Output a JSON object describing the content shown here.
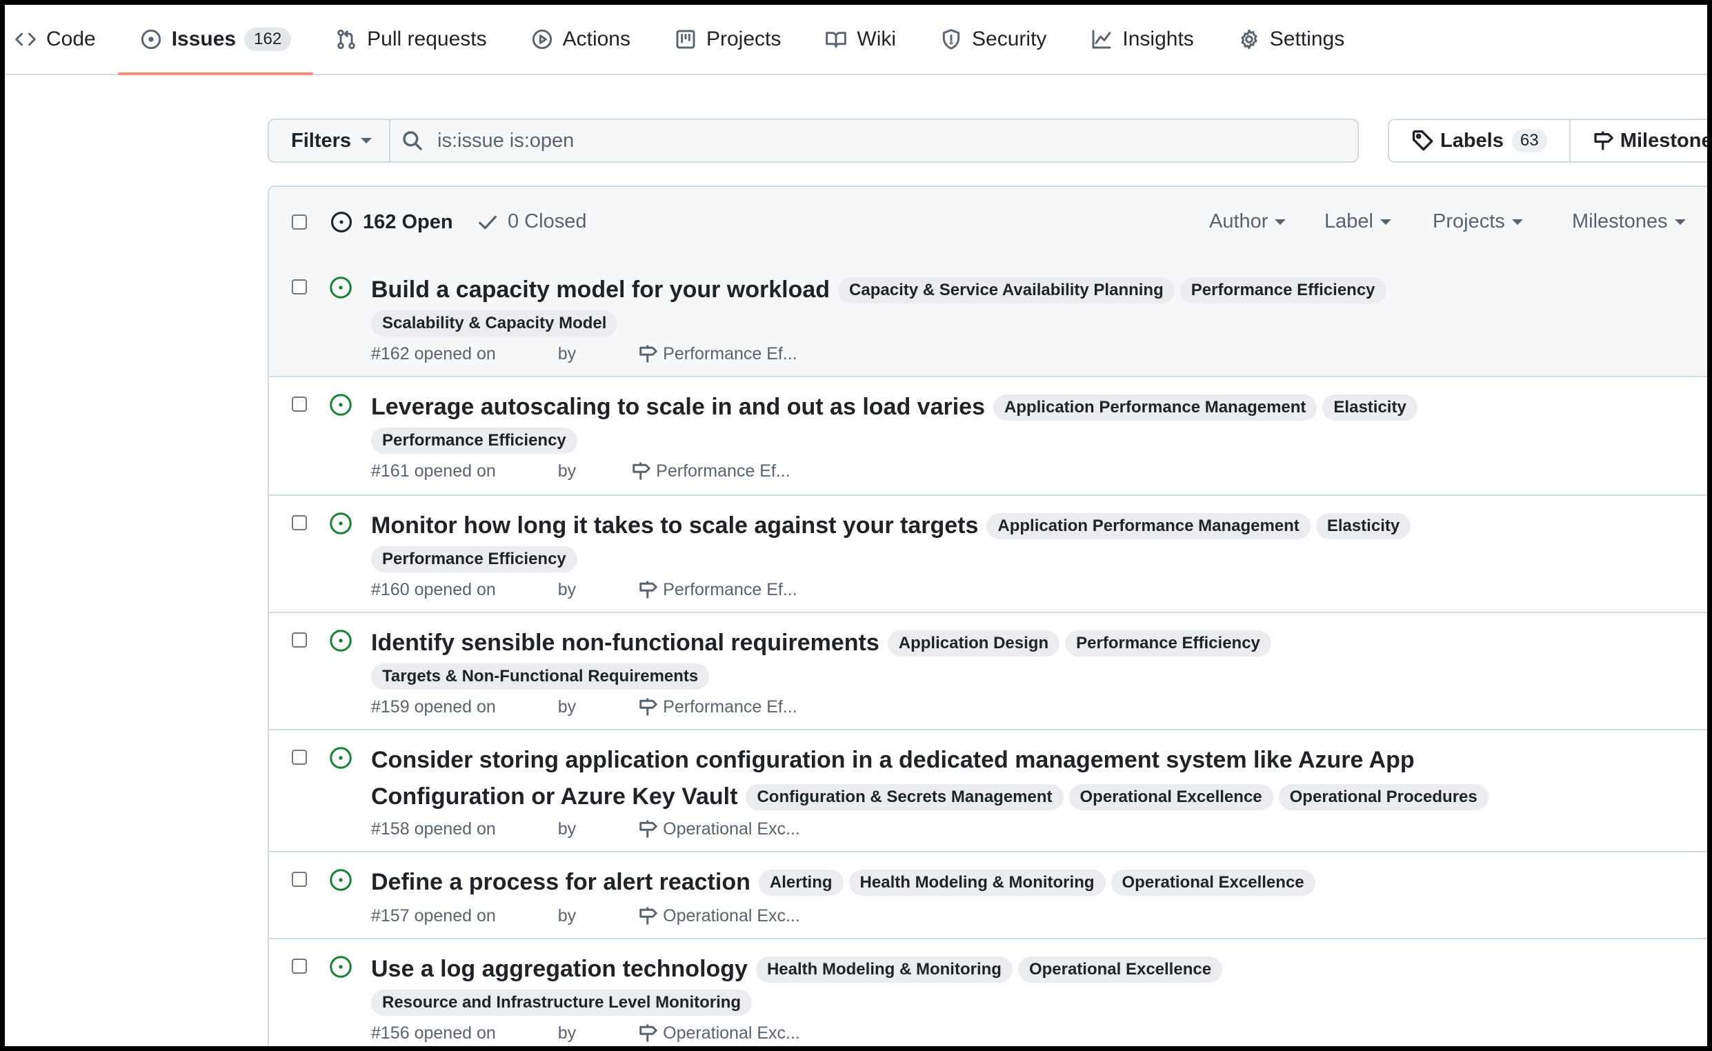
{
  "nav": {
    "tabs": [
      {
        "label": "Code",
        "icon": "code-icon"
      },
      {
        "label": "Issues",
        "icon": "issue-opened-icon",
        "count": "162",
        "selected": true
      },
      {
        "label": "Pull requests",
        "icon": "git-pull-request-icon"
      },
      {
        "label": "Actions",
        "icon": "play-icon"
      },
      {
        "label": "Projects",
        "icon": "project-board-icon"
      },
      {
        "label": "Wiki",
        "icon": "book-icon"
      },
      {
        "label": "Security",
        "icon": "shield-icon"
      },
      {
        "label": "Insights",
        "icon": "graph-icon"
      },
      {
        "label": "Settings",
        "icon": "gear-icon"
      }
    ]
  },
  "filterbar": {
    "filters_label": "Filters",
    "search_value": "is:issue is:open",
    "labels_label": "Labels",
    "labels_count": "63",
    "milestones_label": "Milestone"
  },
  "list_header": {
    "open_label": "162 Open",
    "closed_label": "0 Closed",
    "filters": [
      "Author",
      "Label",
      "Projects",
      "Milestones"
    ]
  },
  "colors": {
    "open_green": "#1a7f37",
    "accent_underline": "#fd8c73"
  },
  "issues": [
    {
      "title": "Build a capacity model for your workload",
      "labels": [
        "Capacity & Service Availability Planning",
        "Performance Efficiency",
        "Scalability & Capacity Model"
      ],
      "number": "#162",
      "opened": "opened on",
      "by": "by",
      "milestone": "Performance Ef..."
    },
    {
      "title": "Leverage autoscaling to scale in and out as load varies",
      "labels": [
        "Application Performance Management",
        "Elasticity",
        "Performance Efficiency"
      ],
      "number": "#161",
      "opened": "opened on",
      "by": "by",
      "milestone": "Performance Ef..."
    },
    {
      "title": "Monitor how long it takes to scale against your targets",
      "labels": [
        "Application Performance Management",
        "Elasticity",
        "Performance Efficiency"
      ],
      "number": "#160",
      "opened": "opened on",
      "by": "by",
      "milestone": "Performance Ef..."
    },
    {
      "title": "Identify sensible non-functional requirements",
      "labels": [
        "Application Design",
        "Performance Efficiency",
        "Targets & Non-Functional Requirements"
      ],
      "number": "#159",
      "opened": "opened on",
      "by": "by",
      "milestone": "Performance Ef..."
    },
    {
      "title": "Consider storing application configuration in a dedicated management system like Azure App Configuration or Azure Key Vault",
      "labels": [
        "Configuration & Secrets Management",
        "Operational Excellence",
        "Operational Procedures"
      ],
      "number": "#158",
      "opened": "opened on",
      "by": "by",
      "milestone": "Operational Exc..."
    },
    {
      "title": "Define a process for alert reaction",
      "labels": [
        "Alerting",
        "Health Modeling & Monitoring",
        "Operational Excellence"
      ],
      "number": "#157",
      "opened": "opened on",
      "by": "by",
      "milestone": "Operational Exc..."
    },
    {
      "title": "Use a log aggregation technology",
      "labels": [
        "Health Modeling & Monitoring",
        "Operational Excellence",
        "Resource and Infrastructure Level Monitoring"
      ],
      "number": "#156",
      "opened": "opened on",
      "by": "by",
      "milestone": "Operational Exc..."
    }
  ]
}
